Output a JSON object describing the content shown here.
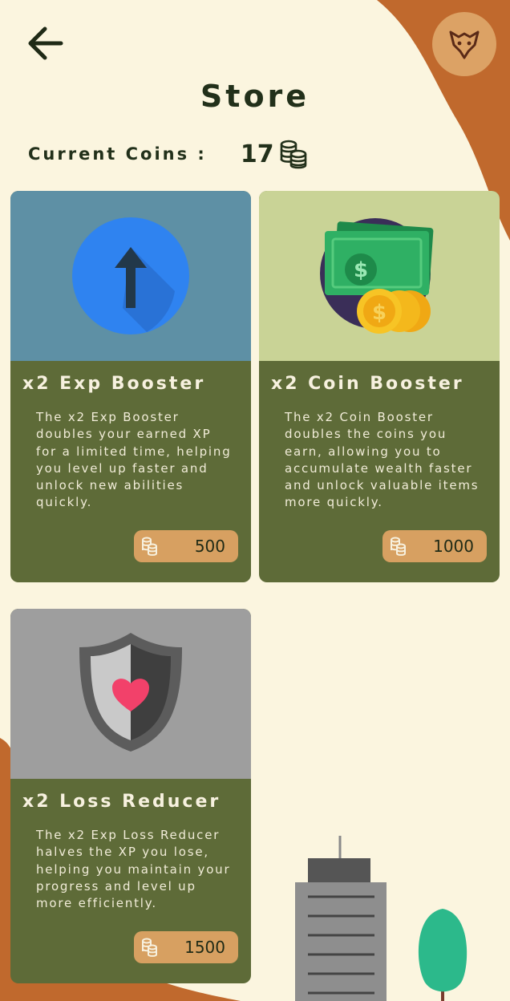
{
  "header": {
    "back_icon": "arrow-left-icon",
    "avatar_icon": "fox-mask-icon",
    "title": "Store"
  },
  "coins": {
    "label": "Current Coins :",
    "value": "17",
    "icon": "coin-stack-icon"
  },
  "colors": {
    "background": "#fbf5df",
    "accent_brown": "#c0692d",
    "card_body": "#5e6b38",
    "price_button": "#d7a061"
  },
  "items": [
    {
      "title": "x2 Exp Booster",
      "description": "The x2 Exp Booster doubles your earned XP for a limited time, helping you level up faster and unlock new abilities quickly.",
      "price": "500",
      "image_icon": "arrow-up-circle-icon",
      "image_bg": "#5e90a5"
    },
    {
      "title": "x2 Coin Booster",
      "description": "The x2 Coin Booster doubles the coins you earn, allowing you to accumulate wealth faster and unlock valuable items more quickly.",
      "price": "1000",
      "image_icon": "money-coins-icon",
      "image_bg": "#c9d396"
    },
    {
      "title": "x2 Loss Reducer",
      "description": "The x2 Exp Loss Reducer halves the XP you lose, helping you maintain your progress and level up more efficiently.",
      "price": "1500",
      "image_icon": "shield-heart-icon",
      "image_bg": "#9e9e9e"
    }
  ]
}
